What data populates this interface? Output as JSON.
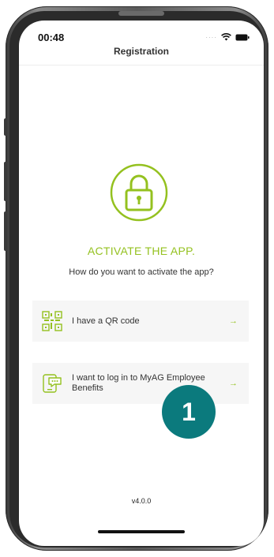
{
  "status_bar": {
    "time": "00:48"
  },
  "nav": {
    "title": "Registration"
  },
  "activate": {
    "title": "ACTIVATE THE APP.",
    "subtitle": "How do you want to activate the app?"
  },
  "options": [
    {
      "label": "I have a QR code",
      "icon": "qr-code-icon",
      "arrow": "→"
    },
    {
      "label": "I want to log in to MyAG Employee Benefits",
      "icon": "sms-phone-icon",
      "arrow": "→"
    }
  ],
  "badge": {
    "text": "1"
  },
  "footer": {
    "version": "v4.0.0"
  },
  "colors": {
    "accent": "#94c11f",
    "badge": "#0b7a7d"
  }
}
